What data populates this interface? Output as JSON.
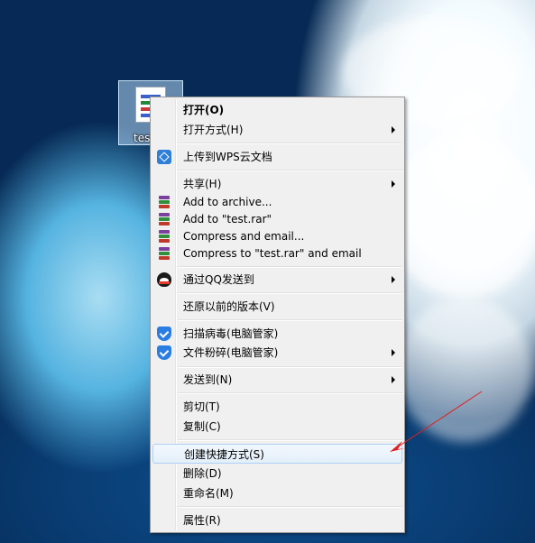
{
  "desktop": {
    "file_label": "test"
  },
  "menu": {
    "items": [
      {
        "label": "打开(O)",
        "bold": true
      },
      {
        "label": "打开方式(H)",
        "submenu": true
      },
      {
        "label": "上传到WPS云文档",
        "icon": "wps-cloud-icon"
      },
      {
        "label": "共享(H)",
        "submenu": true
      },
      {
        "label": "Add to archive...",
        "icon": "winrar-icon"
      },
      {
        "label": "Add to \"test.rar\"",
        "icon": "winrar-icon"
      },
      {
        "label": "Compress and email...",
        "icon": "winrar-icon"
      },
      {
        "label": "Compress to \"test.rar\" and email",
        "icon": "winrar-icon"
      },
      {
        "label": "通过QQ发送到",
        "icon": "qq-penguin-icon",
        "submenu": true
      },
      {
        "label": "还原以前的版本(V)"
      },
      {
        "label": "扫描病毒(电脑管家)",
        "icon": "tencent-shield-icon"
      },
      {
        "label": "文件粉碎(电脑管家)",
        "icon": "tencent-shield-icon",
        "submenu": true
      },
      {
        "label": "发送到(N)",
        "submenu": true
      },
      {
        "label": "剪切(T)"
      },
      {
        "label": "复制(C)"
      },
      {
        "label": "创建快捷方式(S)",
        "highlighted": true
      },
      {
        "label": "删除(D)"
      },
      {
        "label": "重命名(M)"
      },
      {
        "label": "属性(R)"
      }
    ]
  },
  "colors": {
    "menu_bg": "#f0f0f0",
    "highlight_border": "#aecff7",
    "annotation_arrow": "#e02020"
  }
}
